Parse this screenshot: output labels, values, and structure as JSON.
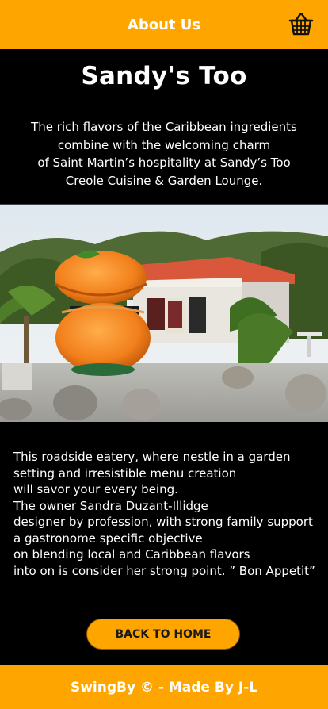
{
  "header": {
    "title": "About Us",
    "cart_icon": "basket-icon"
  },
  "hero": {
    "title": "Sandy's Too",
    "description_lines": [
      "The rich flavors of the Caribbean ingredients",
      "combine with the welcoming charm",
      "of Saint Martin’s hospitality at Sandy’s Too",
      "Creole Cuisine & Garden Lounge."
    ]
  },
  "photo": {
    "alt_icon": "restaurant-photo"
  },
  "body": {
    "lines": [
      "This roadside eatery, where nestle in a garden",
      "setting and irresistible menu creation",
      "will savor your every being.",
      "The owner Sandra Duzant-Illidge",
      "designer by profession, with strong family support",
      "a gastronome specific objective",
      "on blending local and Caribbean flavors",
      "into on is consider her strong point. ” Bon Appetit”"
    ]
  },
  "button": {
    "label": "BACK TO HOME"
  },
  "footer": {
    "text": "SwingBy © - Made By J-L"
  },
  "colors": {
    "accent": "#ffa500",
    "background": "#000000",
    "text": "#ffffff"
  }
}
